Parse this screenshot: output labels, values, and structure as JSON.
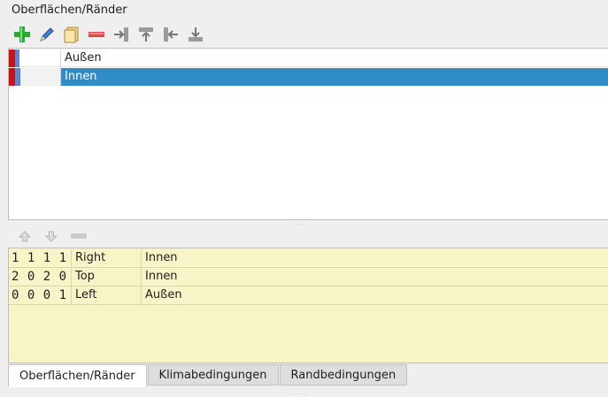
{
  "panel": {
    "title": "Oberflächen/Ränder"
  },
  "toolbar": {
    "icons": [
      "add-icon",
      "edit-pencil-icon",
      "copy-icon",
      "remove-icon",
      "align-right-icon",
      "align-top-icon",
      "align-left-icon",
      "align-bottom-icon"
    ]
  },
  "surfaces": {
    "rows": [
      {
        "name": "Außen",
        "selected": false,
        "color": "#cc1212"
      },
      {
        "name": "Innen",
        "selected": true,
        "color": "#cc1212"
      }
    ]
  },
  "assignments": {
    "toolbar_icons": [
      "move-up-icon",
      "move-down-icon",
      "remove-icon"
    ],
    "rows": [
      {
        "coords": "1 1 1 1",
        "side": "Right",
        "surface": "Innen"
      },
      {
        "coords": "2 0 2 0",
        "side": "Top",
        "surface": "Innen"
      },
      {
        "coords": "0 0 0 1",
        "side": "Left",
        "surface": "Außen"
      }
    ]
  },
  "tabs": [
    {
      "label": "Oberflächen/Ränder",
      "active": true
    },
    {
      "label": "Klimabedingungen",
      "active": false
    },
    {
      "label": "Randbedingungen",
      "active": false
    }
  ],
  "colors": {
    "selection": "#308cc6",
    "table_bg": "#f7f4c8",
    "surface_color": "#cc1212"
  }
}
